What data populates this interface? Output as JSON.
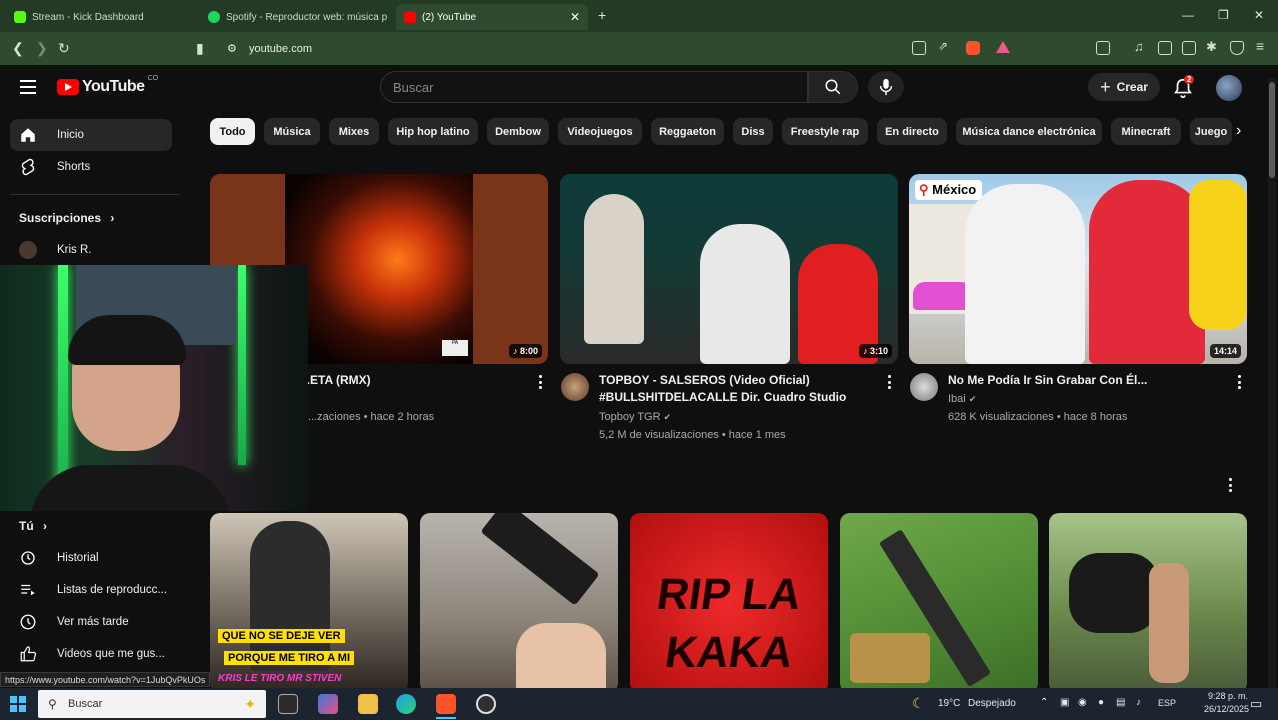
{
  "browser": {
    "tabs": [
      {
        "title": "Stream - Kick Dashboard",
        "favicon_color": "#53fc18"
      },
      {
        "title": "Spotify - Reproductor web: música p",
        "favicon_color": "#1ed760"
      },
      {
        "title": "(2) YouTube",
        "favicon_color": "#ff0000"
      }
    ],
    "url": "youtube.com"
  },
  "yt": {
    "logo_text": "YouTube",
    "country_code": "CO",
    "search_placeholder": "Buscar",
    "create_label": "Crear",
    "notif_count": "2",
    "accent": "#ff0000"
  },
  "sidebar": {
    "home": "Inicio",
    "shorts": "Shorts",
    "subs_header": "Suscripciones",
    "sub_channel": "Kris R.",
    "you_header": "Tú",
    "items": [
      "Historial",
      "Listas de reproducc...",
      "Ver más tarde",
      "Videos que me gus..."
    ]
  },
  "chips": [
    "Todo",
    "Música",
    "Mixes",
    "Hip hop latino",
    "Dembow",
    "Videojuegos",
    "Reggaeton",
    "Diss",
    "Freestyle rap",
    "En directo",
    "Música dance electrónica",
    "Minecraft",
    "Juego"
  ],
  "videos": [
    {
      "title": "...ETA (RMX)",
      "channel": "",
      "meta": "...zaciones • hace 2 horas",
      "duration": "8:00",
      "music": true
    },
    {
      "title": "TOPBOY - SALSEROS (Video Oficial) #BULLSHITDELACALLE Dir. Cuadro Studio",
      "title_l1": "TOPBOY - SALSEROS (Video Oficial)",
      "title_l2": "#BULLSHITDELACALLE Dir. Cuadro Studio",
      "channel": "Topboy TGR",
      "meta": "5,2 M de visualizaciones • hace 1 mes",
      "duration": "3:10",
      "music": true
    },
    {
      "title": "No Me Podía Ir Sin Grabar Con Él...",
      "channel": "Ibai",
      "meta": "628 K visualizaciones • hace 8 horas",
      "duration": "14:14",
      "badge": "México"
    }
  ],
  "row2": [
    {
      "overlay_line1": "QUE NO SE DEJE VER",
      "overlay_line2": "PORQUE ME TIRO A MI",
      "overlay_line3": "KRIS LE TIRO MR STIVEN"
    },
    {},
    {
      "overlay_text_1": "RIP LA",
      "overlay_text_2": "KAKA"
    },
    {},
    {}
  ],
  "status_url": "https://www.youtube.com/watch?v=1JubQvPkUOs",
  "taskbar": {
    "search_placeholder": "Buscar",
    "weather": "19°C",
    "weather_desc": "Despejado",
    "lang": "ESP",
    "time": "9:28 p. m.",
    "date": "26/12/2025"
  }
}
